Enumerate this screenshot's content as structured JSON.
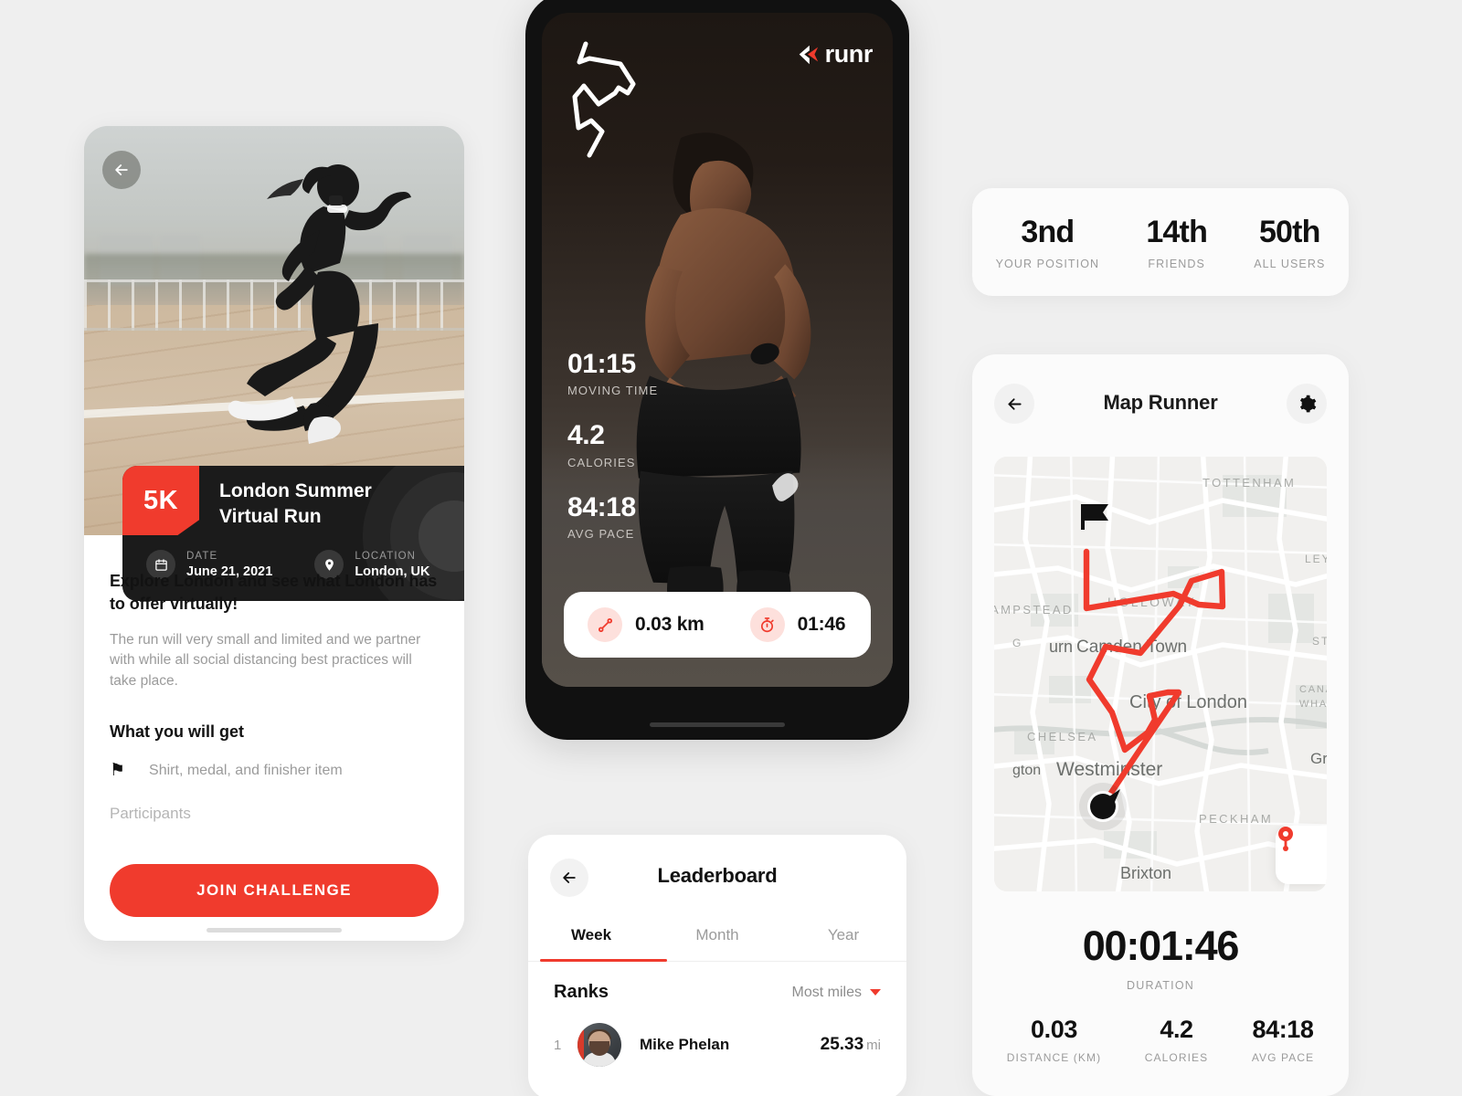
{
  "left_screen": {
    "back_icon": "arrow-left-icon",
    "event": {
      "badge": "5K",
      "title": "London Summer Virtual Run",
      "date_label": "DATE",
      "date_value": "June 21, 2021",
      "location_label": "LOCATION",
      "location_value": "London, UK",
      "calendar_icon": "calendar-icon",
      "pin_icon": "map-pin-icon"
    },
    "headline": "Explore London and see what London has to offer virtually!",
    "paragraph": "The run will very small and limited and we partner with while all social distancing best practices will take place.",
    "perks_heading": "What you will get",
    "perk_icon": "flag-icon",
    "perk_text": "Shirt, medal, and finisher item",
    "participants_label": "Participants",
    "cta_label": "JOIN CHALLENGE"
  },
  "phone_screen": {
    "brand": "runr",
    "brand_mark_icon": "runr-chevron-icon",
    "route_sketch_icon": "route-sketch-icon",
    "stats": [
      {
        "value": "01:15",
        "label": "MOVING TIME"
      },
      {
        "value": "4.2",
        "label": "CALORIES"
      },
      {
        "value": "84:18",
        "label": "AVG PACE"
      }
    ],
    "pill": {
      "distance_icon": "route-icon",
      "distance": "0.03 km",
      "timer_icon": "stopwatch-icon",
      "time": "01:46"
    }
  },
  "leaderboard": {
    "back_icon": "arrow-left-icon",
    "title": "Leaderboard",
    "tabs": [
      {
        "label": "Week",
        "active": true
      },
      {
        "label": "Month",
        "active": false
      },
      {
        "label": "Year",
        "active": false
      }
    ],
    "ranks_heading": "Ranks",
    "sort_label": "Most miles",
    "sort_caret_icon": "caret-down-icon",
    "rows": [
      {
        "rank": "1",
        "name": "Mike Phelan",
        "value": "25.33",
        "unit": "mi"
      }
    ]
  },
  "position_card": {
    "items": [
      {
        "value": "3nd",
        "label": "YOUR POSITION"
      },
      {
        "value": "14th",
        "label": "FRIENDS"
      },
      {
        "value": "50th",
        "label": "ALL USERS"
      }
    ]
  },
  "map_screen": {
    "back_icon": "arrow-left-icon",
    "title": "Map Runner",
    "gear_icon": "gear-icon",
    "start_flag_icon": "flag-icon",
    "current_pos_icon": "location-arrow-icon",
    "recenter_icon": "map-pin-icon",
    "map_labels": [
      "TOTTENHAM",
      "AMPSTEAD",
      "HOLLOWAY",
      "Camden Town",
      "urn",
      "City of London",
      "Westminster",
      "gton",
      "CHELSEA",
      "PECKHAM",
      "Brixton",
      "CANARY",
      "WHARF",
      "Gree",
      "LEY",
      "STR",
      "G"
    ],
    "duration_value": "00:01:46",
    "duration_label": "DURATION",
    "mini_stats": [
      {
        "value": "0.03",
        "label": "DISTANCE (KM)"
      },
      {
        "value": "4.2",
        "label": "CALORIES"
      },
      {
        "value": "84:18",
        "label": "AVG PACE"
      }
    ]
  },
  "colors": {
    "accent": "#f03b2d",
    "dark": "#1b1b1b",
    "page_bg": "#efefef",
    "muted_text": "#9b9b9b"
  }
}
